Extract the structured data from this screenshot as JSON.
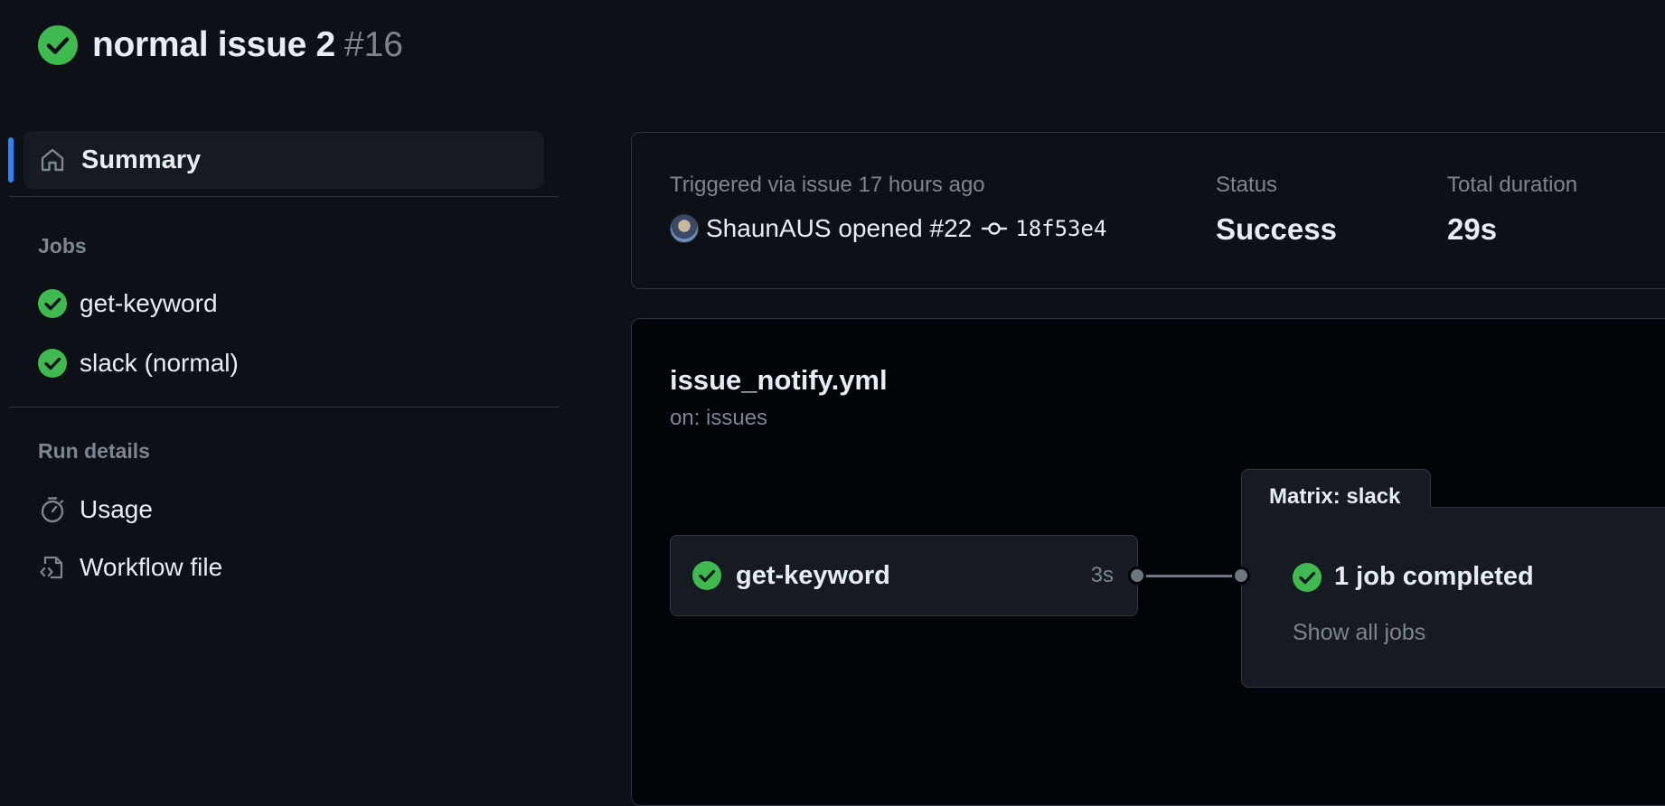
{
  "run": {
    "title": "normal issue 2",
    "number": "#16",
    "status_icon": "check-circle-icon",
    "status_color": "#3fb950"
  },
  "sidebar": {
    "summary_label": "Summary",
    "jobs_heading": "Jobs",
    "jobs": [
      {
        "label": "get-keyword",
        "icon": "check-circle-icon"
      },
      {
        "label": "slack (normal)",
        "icon": "check-circle-icon"
      }
    ],
    "run_details_heading": "Run details",
    "details": [
      {
        "label": "Usage",
        "icon": "stopwatch-icon"
      },
      {
        "label": "Workflow file",
        "icon": "file-code-icon"
      }
    ],
    "active_color": "#2f81f7"
  },
  "summary": {
    "triggered_label": "Triggered via issue 17 hours ago",
    "trigger_text": "ShaunAUS opened #22",
    "commit_sha": "18f53e4",
    "status_label": "Status",
    "status_value": "Success",
    "duration_label": "Total duration",
    "duration_value": "29s"
  },
  "workflow": {
    "file": "issue_notify.yml",
    "trigger": "on: issues",
    "job": {
      "name": "get-keyword",
      "duration": "3s"
    },
    "matrix": {
      "title": "Matrix: slack",
      "status": "1 job completed",
      "show_all": "Show all jobs"
    }
  }
}
